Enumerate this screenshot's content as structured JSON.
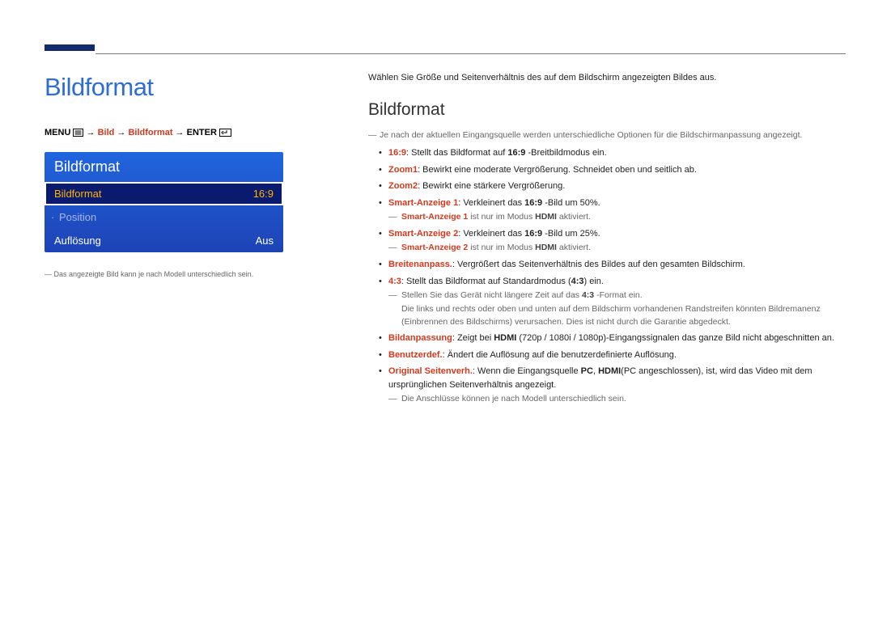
{
  "page_title": "Bildformat",
  "nav": {
    "menu": "MENU",
    "seg1": "Bild",
    "seg2": "Bildformat",
    "enter": "ENTER"
  },
  "panel": {
    "title": "Bildformat",
    "rows": [
      {
        "label": "Bildformat",
        "value": "16:9",
        "selected": true
      },
      {
        "label": "Position",
        "value": "",
        "dim": true,
        "sub": true
      },
      {
        "label": "Auflösung",
        "value": "Aus"
      }
    ]
  },
  "image_note": "Das angezeigte Bild kann je nach Modell unterschiedlich sein.",
  "intro": "Wählen Sie Größe und Seitenverhältnis des auf dem Bildschirm angezeigten Bildes aus.",
  "section_title": "Bildformat",
  "top_note": "Je nach der aktuellen Eingangsquelle werden unterschiedliche Optionen für die Bildschirmanpassung angezeigt.",
  "items": {
    "i1a": "16:9",
    "i1b": ": Stellt das Bildformat auf ",
    "i1c": "16:9",
    "i1d": " -Breitbildmodus ein.",
    "i2a": "Zoom1",
    "i2b": ": Bewirkt eine moderate Vergrößerung. Schneidet oben und seitlich ab.",
    "i3a": "Zoom2",
    "i3b": ": Bewirkt eine stärkere Vergrößerung.",
    "i4a": "Smart-Anzeige 1",
    "i4b": ": Verkleinert das ",
    "i4c": "16:9",
    "i4d": " -Bild um 50%.",
    "n4a": "Smart-Anzeige 1",
    "n4b": " ist nur im Modus ",
    "n4c": "HDMI",
    "n4d": " aktiviert.",
    "i5a": "Smart-Anzeige 2",
    "i5b": ": Verkleinert das ",
    "i5c": "16:9",
    "i5d": " -Bild um 25%.",
    "n5a": "Smart-Anzeige 2",
    "n5b": " ist nur im Modus ",
    "n5c": "HDMI",
    "n5d": " aktiviert.",
    "i6a": "Breitenanpass.",
    "i6b": ": Vergrößert das Seitenverhältnis des Bildes auf den gesamten Bildschirm.",
    "i7a": "4:3",
    "i7b": ": Stellt das Bildformat auf Standardmodus (",
    "i7c": "4:3",
    "i7d": ") ein.",
    "n7a": "Stellen Sie das Gerät nicht längere Zeit auf das ",
    "n7b": "4:3",
    "n7c": " -Format ein.",
    "n7line2": "Die links und rechts oder oben und unten auf dem Bildschirm vorhandenen Randstreifen könnten Bildremanenz (Einbrennen des Bildschirms) verursachen. Dies ist nicht durch die Garantie abgedeckt.",
    "i8a": "Bildanpassung",
    "i8b": ": Zeigt bei ",
    "i8c": "HDMI",
    "i8d": " (720p / 1080i / 1080p)-Eingangssignalen das ganze Bild nicht abgeschnitten an.",
    "i9a": "Benutzerdef.",
    "i9b": ": Ändert die Auflösung auf die benutzerdefinierte Auflösung.",
    "i10a": "Original Seitenverh.",
    "i10b": ": Wenn die Eingangsquelle ",
    "i10c": "PC",
    "i10d": ", ",
    "i10e": "HDMI",
    "i10f": "(PC angeschlossen), ist, wird das Video mit dem ursprünglichen Seitenverhältnis angezeigt.",
    "n10": "Die Anschlüsse können je nach Modell unterschiedlich sein."
  }
}
